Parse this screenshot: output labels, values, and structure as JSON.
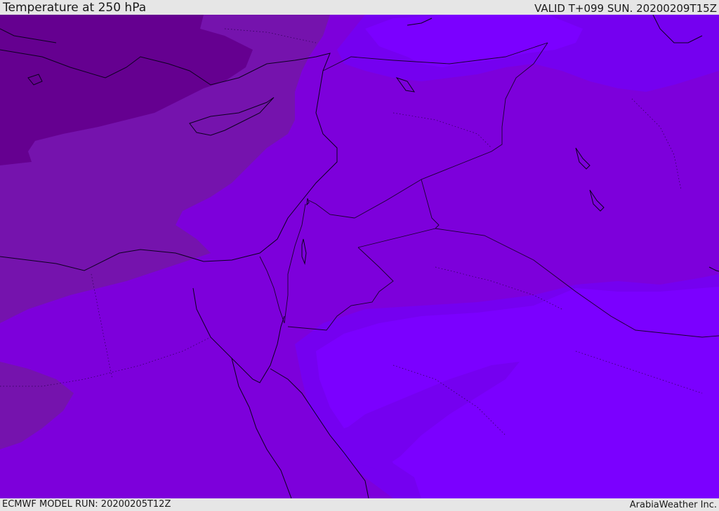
{
  "header": {
    "title": "Temperature at 250 hPa",
    "valid_time": "VALID T+099 SUN. 20200209T15Z"
  },
  "footer": {
    "model_run": "ECMWF MODEL RUN: 20200205T12Z",
    "credit": "ArabiaWeather Inc."
  },
  "colors": {
    "coldest": "#650090",
    "colder": "#7513ad",
    "base": "#7d00db",
    "warm": "#7500f0",
    "warmest": "#7b00ff",
    "coastline": "#0d0020",
    "border": "#1a0030"
  }
}
